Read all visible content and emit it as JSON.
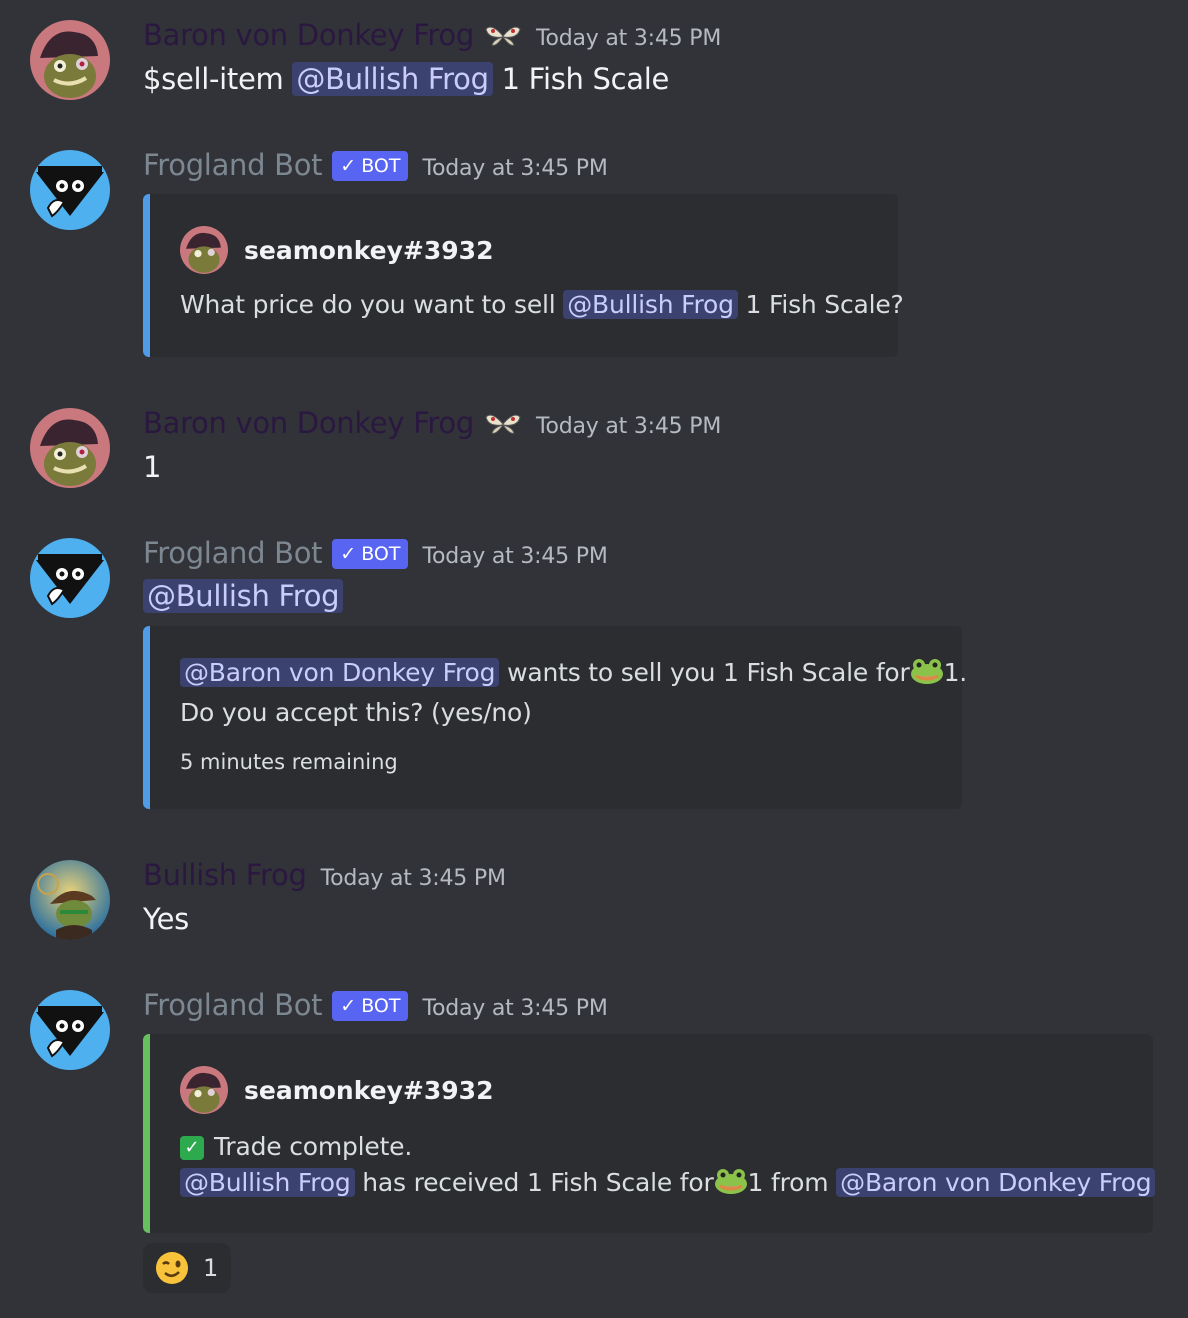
{
  "messages": [
    {
      "author": "Baron von Donkey Frog",
      "timestamp": "Today at 3:45 PM",
      "content": {
        "command": "$sell-item",
        "mention": "@Bullish Frog",
        "rest": "1 Fish Scale"
      }
    },
    {
      "author": "Frogland Bot",
      "badge": "BOT",
      "timestamp": "Today at 3:45 PM",
      "embed": {
        "author": "seamonkey#3932",
        "desc_pre": "What price do you want to sell",
        "mention": "@Bullish Frog",
        "desc_post": "1 Fish Scale?"
      }
    },
    {
      "author": "Baron von Donkey Frog",
      "timestamp": "Today at 3:45 PM",
      "content": {
        "text": "1"
      }
    },
    {
      "author": "Frogland Bot",
      "badge": "BOT",
      "timestamp": "Today at 3:45 PM",
      "content": {
        "mention": "@Bullish Frog"
      },
      "embed": {
        "mention": "@Baron von Donkey Frog",
        "line1_post": "wants to sell you 1 Fish Scale for",
        "line1_end": "1.",
        "line2": "Do you accept this? (yes/no)",
        "footer": "5 minutes remaining"
      }
    },
    {
      "author": "Bullish Frog",
      "timestamp": "Today at 3:45 PM",
      "content": {
        "text": "Yes"
      }
    },
    {
      "author": "Frogland Bot",
      "badge": "BOT",
      "timestamp": "Today at 3:45 PM",
      "embed": {
        "author": "seamonkey#3932",
        "line1": "Trade complete.",
        "mention1": "@Bullish Frog",
        "line2_mid": "has received 1 Fish Scale for",
        "line2_amount": "1 from",
        "mention2": "@Baron von Donkey Frog"
      },
      "reaction": {
        "emoji": "winking-face",
        "count": "1"
      }
    }
  ],
  "colors": {
    "background": "#313338",
    "mention_bg": "#3c4270",
    "mention_text": "#c9cdfb",
    "bot_badge": "#5865f2",
    "embed_blue": "#4f9de8",
    "embed_green": "#67c05e"
  }
}
